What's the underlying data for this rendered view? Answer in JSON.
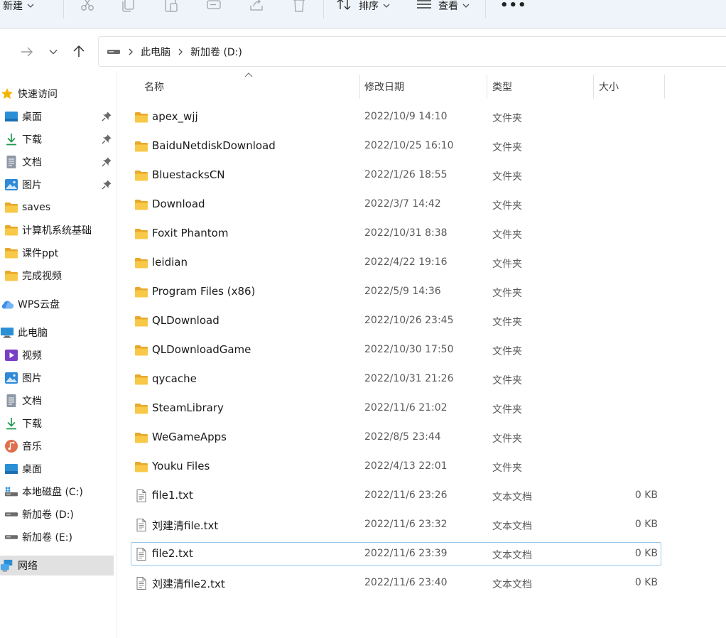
{
  "toolbar": {
    "new_label": "新建",
    "sort_label": "排序",
    "view_label": "查看",
    "more_label": "•••",
    "icons": [
      "cut-icon",
      "copy-icon",
      "paste-icon",
      "rename-icon",
      "share-icon",
      "delete-icon"
    ]
  },
  "address": {
    "drive_icon": "drive-icon",
    "crumbs": [
      "此电脑",
      "新加卷 (D:)"
    ]
  },
  "columns": {
    "name": "名称",
    "date": "修改日期",
    "type": "类型",
    "size": "大小"
  },
  "sidebar": {
    "items": [
      {
        "label": "快速访问",
        "icon": "star-icon",
        "indent": 0,
        "pinned": false
      },
      {
        "label": "桌面",
        "icon": "desktop-icon",
        "indent": 1,
        "pinned": true
      },
      {
        "label": "下载",
        "icon": "download-icon",
        "indent": 1,
        "pinned": true
      },
      {
        "label": "文档",
        "icon": "document-icon",
        "indent": 1,
        "pinned": true
      },
      {
        "label": "图片",
        "icon": "pictures-icon",
        "indent": 1,
        "pinned": true
      },
      {
        "label": "saves",
        "icon": "folder-icon",
        "indent": 1,
        "pinned": false
      },
      {
        "label": "计算机系统基础",
        "icon": "folder-icon",
        "indent": 1,
        "pinned": false
      },
      {
        "label": "课件ppt",
        "icon": "folder-icon",
        "indent": 1,
        "pinned": false
      },
      {
        "label": "完成视频",
        "icon": "folder-icon",
        "indent": 1,
        "pinned": false
      },
      {
        "label": "WPS云盘",
        "icon": "cloud-icon",
        "indent": 0,
        "pinned": false
      },
      {
        "label": "此电脑",
        "icon": "computer-icon",
        "indent": 0,
        "pinned": false
      },
      {
        "label": "视频",
        "icon": "video-icon",
        "indent": 1,
        "pinned": false
      },
      {
        "label": "图片",
        "icon": "pictures-icon",
        "indent": 1,
        "pinned": false
      },
      {
        "label": "文档",
        "icon": "document-icon",
        "indent": 1,
        "pinned": false
      },
      {
        "label": "下载",
        "icon": "download-icon",
        "indent": 1,
        "pinned": false
      },
      {
        "label": "音乐",
        "icon": "music-icon",
        "indent": 1,
        "pinned": false
      },
      {
        "label": "桌面",
        "icon": "desktop-icon",
        "indent": 1,
        "pinned": false
      },
      {
        "label": "本地磁盘 (C:)",
        "icon": "system-drive-icon",
        "indent": 1,
        "pinned": false
      },
      {
        "label": "新加卷 (D:)",
        "icon": "drive-icon",
        "indent": 1,
        "pinned": false
      },
      {
        "label": "新加卷 (E:)",
        "icon": "drive-icon",
        "indent": 1,
        "pinned": false
      },
      {
        "label": "网络",
        "icon": "network-icon",
        "indent": 0,
        "pinned": false,
        "selected": true
      }
    ]
  },
  "files": [
    {
      "name": "apex_wjj",
      "date": "2022/10/9 14:10",
      "type": "文件夹",
      "size": "",
      "kind": "folder"
    },
    {
      "name": "BaiduNetdiskDownload",
      "date": "2022/10/25 16:10",
      "type": "文件夹",
      "size": "",
      "kind": "folder"
    },
    {
      "name": "BluestacksCN",
      "date": "2022/1/26 18:55",
      "type": "文件夹",
      "size": "",
      "kind": "folder"
    },
    {
      "name": "Download",
      "date": "2022/3/7 14:42",
      "type": "文件夹",
      "size": "",
      "kind": "folder"
    },
    {
      "name": "Foxit Phantom",
      "date": "2022/10/31 8:38",
      "type": "文件夹",
      "size": "",
      "kind": "folder"
    },
    {
      "name": "leidian",
      "date": "2022/4/22 19:16",
      "type": "文件夹",
      "size": "",
      "kind": "folder"
    },
    {
      "name": "Program Files (x86)",
      "date": "2022/5/9 14:36",
      "type": "文件夹",
      "size": "",
      "kind": "folder"
    },
    {
      "name": "QLDownload",
      "date": "2022/10/26 23:45",
      "type": "文件夹",
      "size": "",
      "kind": "folder"
    },
    {
      "name": "QLDownloadGame",
      "date": "2022/10/30 17:50",
      "type": "文件夹",
      "size": "",
      "kind": "folder"
    },
    {
      "name": "qycache",
      "date": "2022/10/31 21:26",
      "type": "文件夹",
      "size": "",
      "kind": "folder"
    },
    {
      "name": "SteamLibrary",
      "date": "2022/11/6 21:02",
      "type": "文件夹",
      "size": "",
      "kind": "folder"
    },
    {
      "name": "WeGameApps",
      "date": "2022/8/5 23:44",
      "type": "文件夹",
      "size": "",
      "kind": "folder"
    },
    {
      "name": "Youku Files",
      "date": "2022/4/13 22:01",
      "type": "文件夹",
      "size": "",
      "kind": "folder"
    },
    {
      "name": "file1.txt",
      "date": "2022/11/6 23:26",
      "type": "文本文档",
      "size": "0 KB",
      "kind": "text"
    },
    {
      "name": "刘建清file.txt",
      "date": "2022/11/6 23:32",
      "type": "文本文档",
      "size": "0 KB",
      "kind": "text"
    },
    {
      "name": "file2.txt",
      "date": "2022/11/6 23:39",
      "type": "文本文档",
      "size": "0 KB",
      "kind": "text",
      "focused": true
    },
    {
      "name": "刘建清file2.txt",
      "date": "2022/11/6 23:40",
      "type": "文本文档",
      "size": "0 KB",
      "kind": "text"
    }
  ],
  "colors": {
    "toolbar_bg": "#eef4f9",
    "folder": "#f6c443",
    "focus_border": "#99c9ef",
    "selected_bg": "#e1e1e1"
  }
}
